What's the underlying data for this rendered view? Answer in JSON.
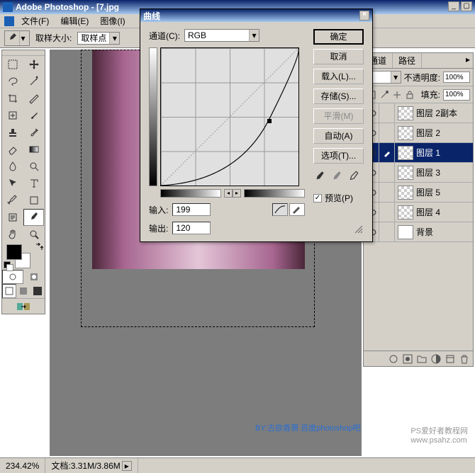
{
  "app": {
    "title": "Adobe Photoshop - [7.jpg"
  },
  "menu": {
    "file": "文件(F)",
    "edit": "编辑(E)",
    "image": "图像(I)"
  },
  "options": {
    "sample_label": "取样大小:",
    "sample_value": "取样点"
  },
  "toolbox": {
    "tools": [
      "marquee",
      "move",
      "lasso",
      "wand",
      "crop",
      "slice",
      "heal",
      "brush",
      "stamp",
      "history-brush",
      "eraser",
      "gradient",
      "blur",
      "dodge",
      "path-select",
      "type",
      "pen",
      "shape",
      "notes",
      "eyedropper",
      "hand",
      "zoom"
    ]
  },
  "curves": {
    "title": "曲线",
    "channel_label": "通道(C):",
    "channel_value": "RGB",
    "input_label": "输入:",
    "input_value": "199",
    "output_label": "输出:",
    "output_value": "120",
    "preview_label": "预览(P)",
    "buttons": {
      "ok": "确定",
      "cancel": "取消",
      "load": "载入(L)...",
      "save": "存储(S)...",
      "smooth": "平滑(M)",
      "auto": "自动(A)",
      "options": "选项(T)..."
    }
  },
  "layers": {
    "tabs": {
      "channels": "通道",
      "paths": "路径"
    },
    "opacity_label": "不透明度:",
    "opacity_value": "100%",
    "fill_label": "填充:",
    "fill_value": "100%",
    "items": [
      {
        "name": "图层 2副本",
        "visible": true,
        "selected": false
      },
      {
        "name": "图层 2",
        "visible": true,
        "selected": false
      },
      {
        "name": "图层 1",
        "visible": true,
        "selected": true
      },
      {
        "name": "图层 3",
        "visible": true,
        "selected": false
      },
      {
        "name": "图层 5",
        "visible": true,
        "selected": false
      },
      {
        "name": "图层 4",
        "visible": true,
        "selected": false
      },
      {
        "name": "背景",
        "visible": true,
        "selected": false,
        "bg": true
      }
    ]
  },
  "status": {
    "zoom": "234.42%",
    "doc_label": "文档:",
    "doc_value": "3.31M/3.86M"
  },
  "watermark": {
    "site": "PS爱好者教程网\nwww.psahz.com",
    "credit": "BY:古欲香萧  百度photoshop吧"
  }
}
